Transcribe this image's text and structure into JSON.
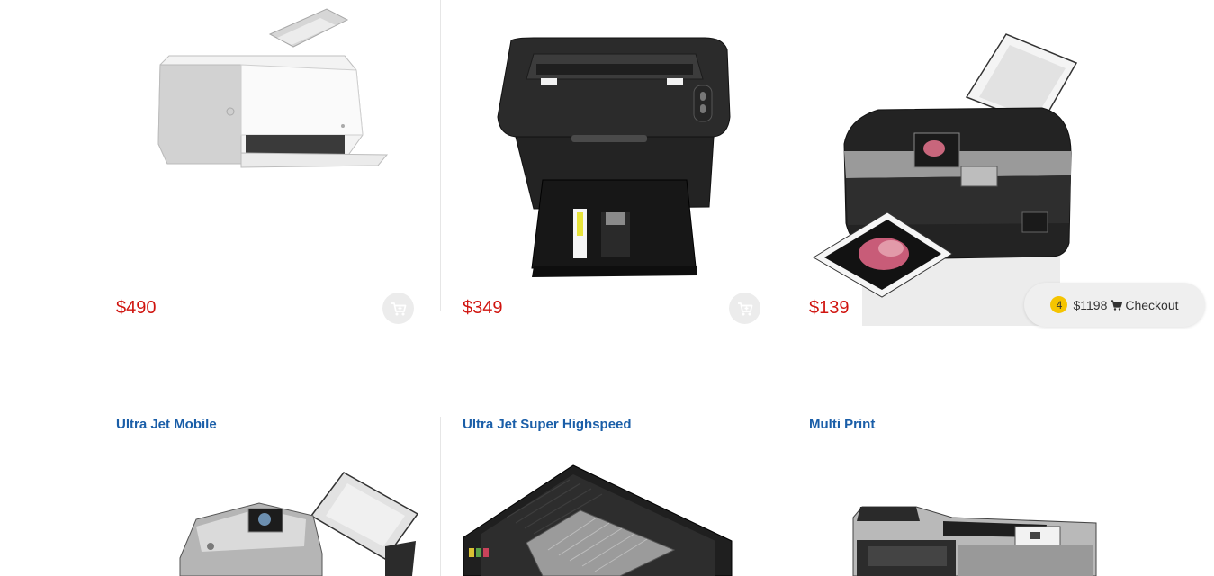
{
  "products_row1": [
    {
      "price": "$490"
    },
    {
      "price": "$349"
    },
    {
      "price": "$139"
    }
  ],
  "products_row2": [
    {
      "title": "Ultra Jet Mobile"
    },
    {
      "title": "Ultra Jet Super Highspeed"
    },
    {
      "title": "Multi Print"
    }
  ],
  "checkout": {
    "count": "4",
    "total": "$1198",
    "label": "Checkout"
  },
  "colors": {
    "price": "#d0140f",
    "title_link": "#1a5ea8",
    "badge": "#f5c400"
  },
  "icons": {
    "add_to_cart": "cart-plus-icon",
    "checkout": "shopping-cart-icon"
  }
}
